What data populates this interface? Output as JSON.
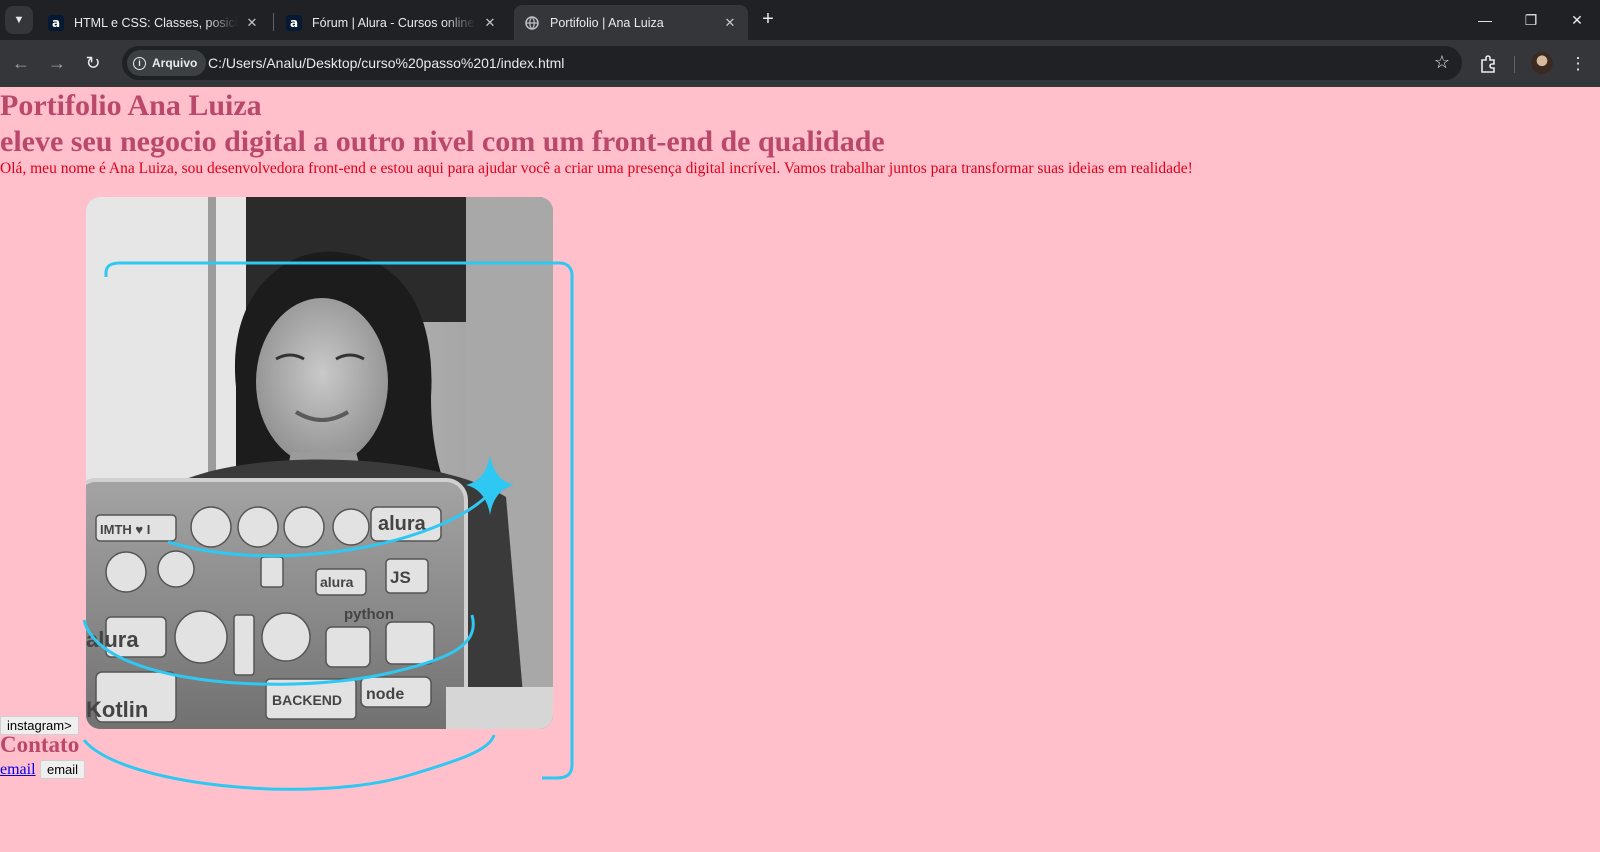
{
  "browser": {
    "tabs": [
      {
        "title": "HTML e CSS: Classes, posicionamento e Flexbox",
        "favicon": "alura-icon",
        "active": false
      },
      {
        "title": "Fórum | Alura - Cursos online de tecnologia",
        "favicon": "alura-icon",
        "active": false
      },
      {
        "title": "Portifolio | Ana Luiza",
        "favicon": "globe-icon",
        "active": true
      }
    ],
    "site_chip": "Arquivo",
    "url": "C:/Users/Analu/Desktop/curso%20passo%201/index.html"
  },
  "page": {
    "title": "Portifolio Ana Luiza",
    "subtitle": "eleve seu negocio digital a outro nivel com um front-end de qualidade",
    "intro": "Olá, meu nome é Ana Luiza, sou desenvolvedora front-end e estou aqui para ajudar você a criar uma presença digital incrível. Vamos trabalhar juntos para transformar suas ideias em realidade!",
    "instagram_button": "instagram>",
    "contact_heading": "Contato",
    "email_link": "email",
    "email_button": "email",
    "sticker_texts": [
      "IMTH ♥ I",
      "alura",
      "JS",
      "alura",
      "python",
      "alura",
      "Kotlin",
      "BACKEND",
      "node"
    ]
  },
  "colors": {
    "page_bg": "#ffc0cb",
    "heading": "#b9486a",
    "intro_text": "#e0001b",
    "accent_line": "#2ec8f3"
  }
}
